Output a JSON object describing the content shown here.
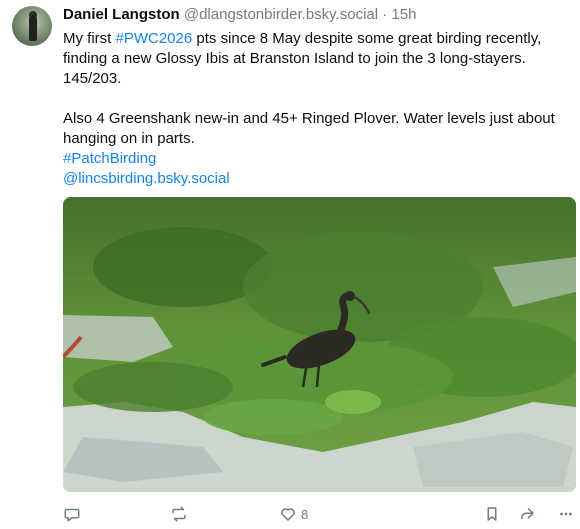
{
  "post": {
    "author": {
      "display_name": "Daniel Langston",
      "handle": "@dlangstonbirder.bsky.social",
      "separator": "·",
      "time": "15h"
    },
    "text": {
      "line1_prefix": "My first ",
      "hashtag_pwc": "#PWC2026",
      "line1_suffix": " pts since 8 May despite some great birding recently, finding a new Glossy Ibis at Branston Island to join the 3 long-stayers. 145/203.",
      "paragraph2": "Also 4 Greenshank new-in and 45+ Ringed Plover. Water levels just about hanging on in parts.",
      "hashtag_patch": "#PatchBirding",
      "mention": "@lincsbirding.bsky.social"
    },
    "media": {
      "kind": "photo",
      "subject": "Glossy Ibis"
    },
    "actions": {
      "reply_icon": "reply-icon",
      "repost_icon": "repost-icon",
      "like_icon": "heart-icon",
      "like_count": "8",
      "bookmark_icon": "bookmark-icon",
      "share_icon": "share-icon",
      "more_icon": "more-icon"
    }
  }
}
